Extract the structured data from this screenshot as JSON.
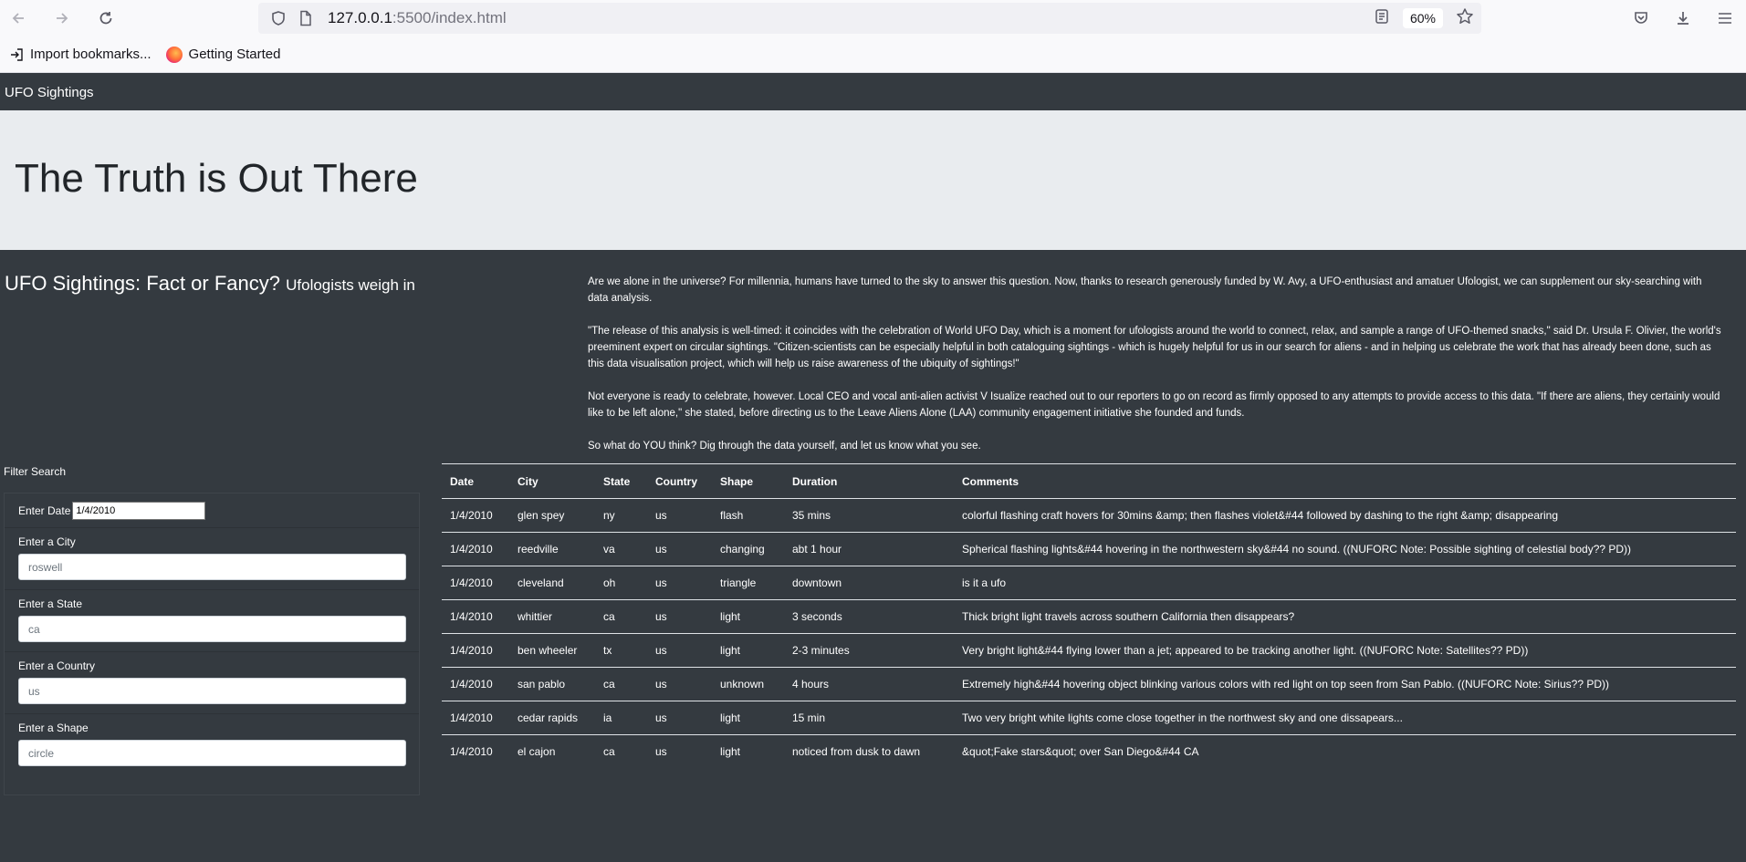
{
  "browser": {
    "url_host": "127.0.0.1",
    "url_rest": ":5500/index.html",
    "zoom": "60%",
    "bookmarks": [
      {
        "label": "Import bookmarks..."
      },
      {
        "label": "Getting Started"
      }
    ]
  },
  "navbar": {
    "brand": "UFO Sightings"
  },
  "jumbotron": {
    "title": "The Truth is Out There"
  },
  "intro": {
    "heading": "UFO Sightings: Fact or Fancy?",
    "subheading": "Ufologists weigh in",
    "paragraphs": [
      "Are we alone in the universe? For millennia, humans have turned to the sky to answer this question. Now, thanks to research generously funded by W. Avy, a UFO-enthusiast and amatuer Ufologist, we can supplement our sky-searching with data analysis.",
      "\"The release of this analysis is well-timed: it coincides with the celebration of World UFO Day, which is a moment for ufologists around the world to connect, relax, and sample a range of UFO-themed snacks,\" said Dr. Ursula F. Olivier, the world's preeminent expert on circular sightings. \"Citizen-scientists can be especially helpful in both cataloguing sightings - which is hugely helpful for us in our search for aliens - and in helping us celebrate the work that has already been done, such as this data visualisation project, which will help us raise awareness of the ubiquity of sightings!\"",
      "Not everyone is ready to celebrate, however. Local CEO and vocal anti-alien activist V Isualize reached out to our reporters to go on record as firmly opposed to any attempts to provide access to this data. \"If there are aliens, they certainly would like to be left alone,\" she stated, before directing us to the Leave Aliens Alone (LAA) community engagement initiative she founded and funds.",
      "So what do YOU think? Dig through the data yourself, and let us know what you see."
    ]
  },
  "filters": {
    "title": "Filter Search",
    "date_label": "Enter Date",
    "date_value": "1/4/2010",
    "city_label": "Enter a City",
    "city_placeholder": "roswell",
    "state_label": "Enter a State",
    "state_placeholder": "ca",
    "country_label": "Enter a Country",
    "country_placeholder": "us",
    "shape_label": "Enter a Shape",
    "shape_placeholder": "circle"
  },
  "table": {
    "headers": [
      "Date",
      "City",
      "State",
      "Country",
      "Shape",
      "Duration",
      "Comments"
    ],
    "rows": [
      [
        "1/4/2010",
        "glen spey",
        "ny",
        "us",
        "flash",
        "35 mins",
        "colorful flashing craft hovers for 30mins &amp; then flashes violet&#44 followed by dashing to the right &amp; disappearing"
      ],
      [
        "1/4/2010",
        "reedville",
        "va",
        "us",
        "changing",
        "abt 1 hour",
        "Spherical flashing lights&#44 hovering in the northwestern sky&#44 no sound. ((NUFORC Note: Possible sighting of celestial body?? PD))"
      ],
      [
        "1/4/2010",
        "cleveland",
        "oh",
        "us",
        "triangle",
        "downtown",
        "is it a ufo"
      ],
      [
        "1/4/2010",
        "whittier",
        "ca",
        "us",
        "light",
        "3 seconds",
        "Thick bright light travels across southern California then disappears?"
      ],
      [
        "1/4/2010",
        "ben wheeler",
        "tx",
        "us",
        "light",
        "2-3 minutes",
        "Very bright light&#44 flying lower than a jet; appeared to be tracking another light. ((NUFORC Note: Satellites?? PD))"
      ],
      [
        "1/4/2010",
        "san pablo",
        "ca",
        "us",
        "unknown",
        "4 hours",
        "Extremely high&#44 hovering object blinking various colors with red light on top seen from San Pablo. ((NUFORC Note: Sirius?? PD))"
      ],
      [
        "1/4/2010",
        "cedar rapids",
        "ia",
        "us",
        "light",
        "15 min",
        "Two very bright white lights come close together in the northwest sky and one dissapears..."
      ],
      [
        "1/4/2010",
        "el cajon",
        "ca",
        "us",
        "light",
        "noticed from dusk to dawn",
        "&quot;Fake stars&quot; over San Diego&#44 CA"
      ]
    ]
  }
}
